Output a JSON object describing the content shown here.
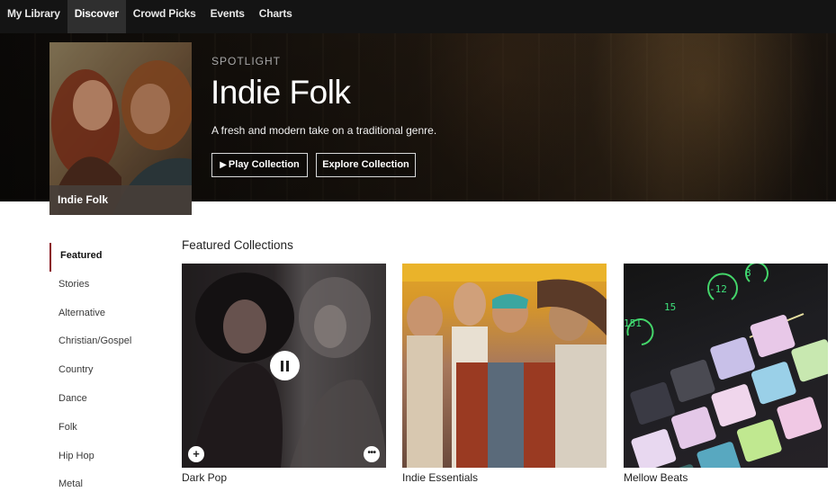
{
  "nav": {
    "tabs": [
      {
        "label": "My Library"
      },
      {
        "label": "Discover"
      },
      {
        "label": "Crowd Picks"
      },
      {
        "label": "Events"
      },
      {
        "label": "Charts"
      }
    ],
    "active_tab": "Discover"
  },
  "spotlight": {
    "kicker": "SPOTLIGHT",
    "title": "Indie Folk",
    "description": "A fresh and modern take on a traditional genre.",
    "cover_caption": "Indie Folk",
    "play_label": "Play Collection",
    "explore_label": "Explore Collection"
  },
  "sidebar": {
    "items": [
      {
        "label": "Featured"
      },
      {
        "label": "Stories"
      },
      {
        "label": "Alternative"
      },
      {
        "label": "Christian/Gospel"
      },
      {
        "label": "Country"
      },
      {
        "label": "Dance"
      },
      {
        "label": "Folk"
      },
      {
        "label": "Hip Hop"
      },
      {
        "label": "Metal"
      }
    ],
    "active_item": "Featured"
  },
  "collections": {
    "title": "Featured Collections",
    "cards": [
      {
        "name": "Dark Pop",
        "state": "playing"
      },
      {
        "name": "Indie Essentials"
      },
      {
        "name": "Mellow Beats"
      }
    ]
  },
  "colors": {
    "nav_bg": "#141414",
    "active_tab_bg": "#2f2f2f",
    "sidebar_accent": "#8a1520"
  },
  "icons": {
    "play": "play-icon",
    "pause": "pause-icon",
    "add": "plus-icon",
    "more": "more-icon"
  }
}
